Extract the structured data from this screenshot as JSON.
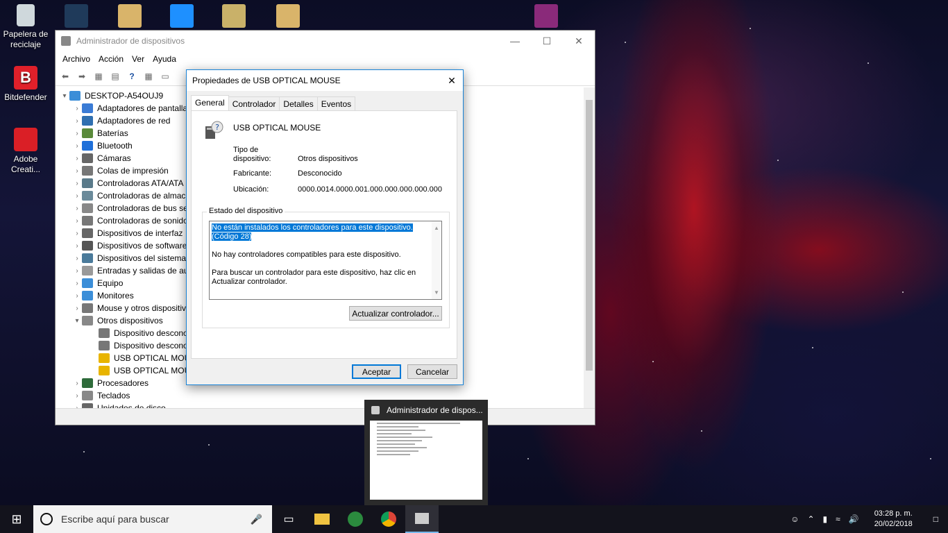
{
  "desktop": {
    "icons": [
      {
        "label": "Papelera de reciclaje"
      },
      {
        "label": "Bitdefender"
      },
      {
        "label": "Adobe Creati..."
      }
    ]
  },
  "device_manager": {
    "title": "Administrador de dispositivos",
    "menu": [
      "Archivo",
      "Acción",
      "Ver",
      "Ayuda"
    ],
    "tree": {
      "root": "DESKTOP-A54OUJ9",
      "items": [
        "Adaptadores de pantalla",
        "Adaptadores de red",
        "Baterías",
        "Bluetooth",
        "Cámaras",
        "Colas de impresión",
        "Controladoras ATA/ATA",
        "Controladoras de almac",
        "Controladoras de bus se",
        "Controladoras de sonido",
        "Dispositivos de interfaz",
        "Dispositivos de software",
        "Dispositivos del sistema",
        "Entradas y salidas de au",
        "Equipo",
        "Monitores",
        "Mouse y otros dispositiv",
        "Otros dispositivos"
      ],
      "children": [
        "Dispositivo descono",
        "Dispositivo descono",
        "USB OPTICAL MOUS",
        "USB OPTICAL MOUS"
      ],
      "after": [
        "Procesadores",
        "Teclados",
        "Unidades de disco"
      ]
    }
  },
  "dialog": {
    "title": "Propiedades de USB OPTICAL MOUSE",
    "tabs": [
      "General",
      "Controlador",
      "Detalles",
      "Eventos"
    ],
    "device_name": "USB OPTICAL MOUSE",
    "type_label": "Tipo de dispositivo:",
    "type_value": "Otros dispositivos",
    "maker_label": "Fabricante:",
    "maker_value": "Desconocido",
    "location_label": "Ubicación:",
    "location_value": "0000.0014.0000.001.000.000.000.000.000",
    "status_group": "Estado del dispositivo",
    "status_line1": "No están instalados los controladores para este dispositivo.",
    "status_line2": "(Código 28)",
    "status_para2": "No hay controladores compatibles para este dispositivo.",
    "status_para3": "Para buscar un controlador para este dispositivo, haz clic en Actualizar controlador.",
    "update_button": "Actualizar controlador...",
    "ok_button": "Aceptar",
    "cancel_button": "Cancelar"
  },
  "preview": {
    "title": "Administrador de dispos..."
  },
  "taskbar": {
    "search_placeholder": "Escribe aquí para buscar",
    "time": "03:28 p. m.",
    "date": "20/02/2018"
  }
}
